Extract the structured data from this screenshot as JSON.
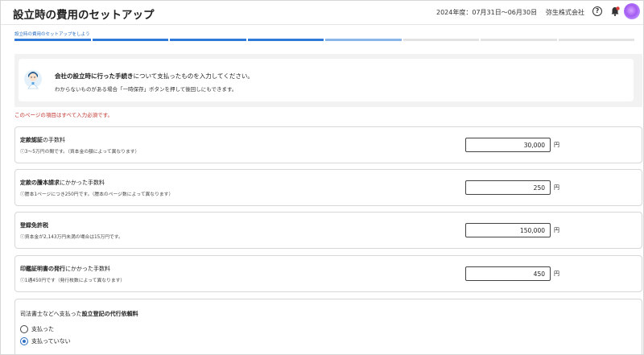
{
  "header": {
    "title": "設立時の費用のセットアップ",
    "fiscal_period": "2024年度：07月31日〜06月30日",
    "company": "弥生株式会社"
  },
  "progress": {
    "step_label": "設立時の費用のセットアップをしよう",
    "segments": [
      "done",
      "done",
      "done",
      "done",
      "cur",
      "todo",
      "todo",
      "todo"
    ]
  },
  "info": {
    "main_bold": "会社の設立時に行った手続き",
    "main_rest": "について支払ったものを入力してください。",
    "sub": "わからないものがある場合「一時保存」ボタンを押して後回しにもできます。"
  },
  "required_note": "このページの項目はすべて入力必須です。",
  "fees": [
    {
      "title_bold": "定款認証",
      "title_rest": "の手数料",
      "hint": "ⓘ3〜5万円の間です。（資本金の額によって異なります）",
      "value": "30,000",
      "unit": "円"
    },
    {
      "title_bold": "定款の謄本請求",
      "title_rest": "にかかった手数料",
      "hint": "ⓘ謄本1ページにつき250円です。（謄本のページ数によって異なります）",
      "value": "250",
      "unit": "円"
    },
    {
      "title_bold": "登録免許税",
      "title_rest": "",
      "hint": "ⓘ資本金が2,143万円未満の場合は15万円です。",
      "value": "150,000",
      "unit": "円"
    },
    {
      "title_bold": "印鑑証明書の発行",
      "title_rest": "にかかった手数料",
      "hint": "ⓘ1通450円です（発行枚数によって異なります）",
      "value": "450",
      "unit": "円"
    }
  ],
  "agent_fee": {
    "title_pre": "司法書士などへ支払った",
    "title_bold": "設立登記の代行依頼料",
    "options": [
      {
        "label": "支払った",
        "selected": false
      },
      {
        "label": "支払っていない",
        "selected": true
      }
    ]
  },
  "colors": {
    "accent": "#2f7ad9",
    "required": "#c0332a"
  }
}
